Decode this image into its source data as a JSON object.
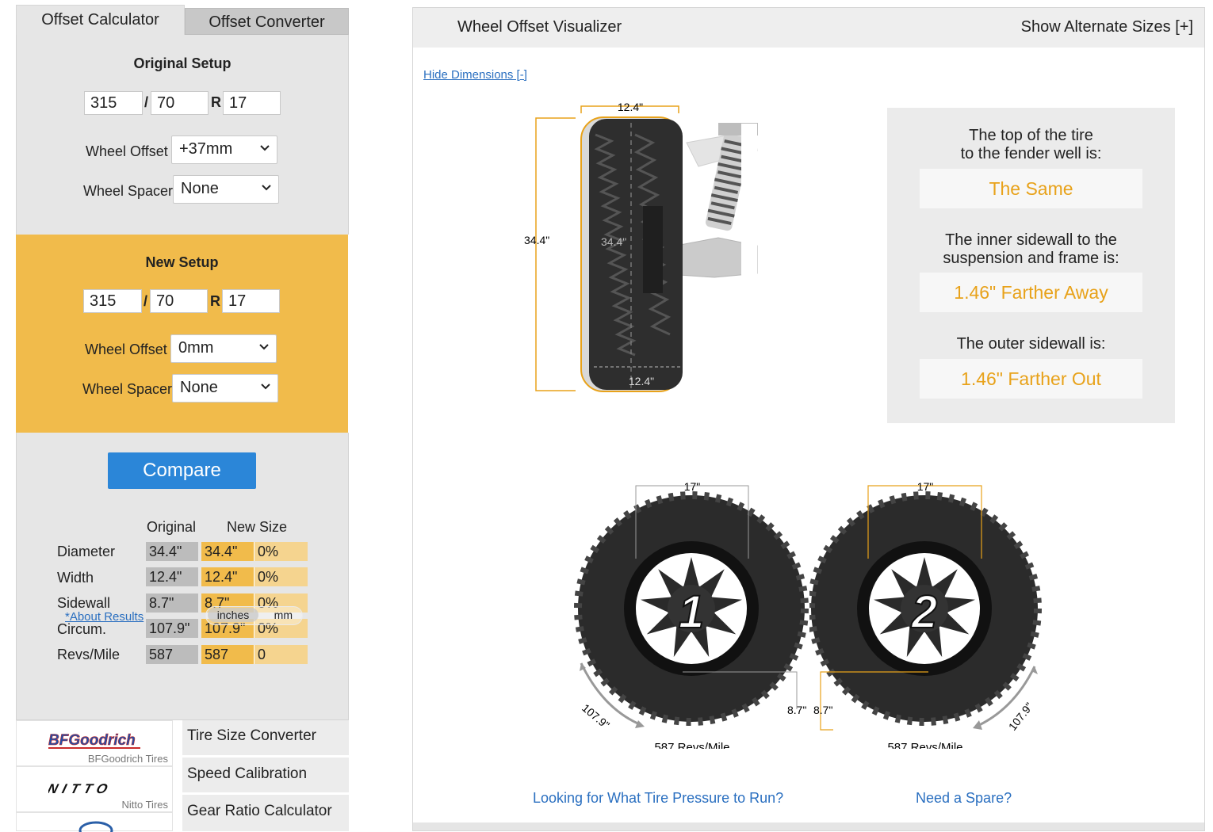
{
  "tabs": {
    "calculator": "Offset Calculator",
    "converter": "Offset Converter"
  },
  "original": {
    "title": "Original Setup",
    "width": "315",
    "aspect": "70",
    "rim": "17",
    "slash": "/",
    "r": "R",
    "offset_label": "Wheel Offset",
    "offset_value": "+37mm",
    "spacer_label": "Wheel Spacer",
    "spacer_value": "None"
  },
  "new_setup": {
    "title": "New Setup",
    "width": "315",
    "aspect": "70",
    "rim": "17",
    "slash": "/",
    "r": "R",
    "offset_label": "Wheel Offset",
    "offset_value": "0mm",
    "spacer_label": "Wheel Spacer",
    "spacer_value": "None"
  },
  "compare_label": "Compare",
  "results": {
    "header_original": "Original",
    "header_new": "New Size",
    "rows": [
      {
        "label": "Diameter",
        "original": "34.4\"",
        "new": "34.4\"",
        "diff": "0%"
      },
      {
        "label": "Width",
        "original": "12.4\"",
        "new": "12.4\"",
        "diff": "0%"
      },
      {
        "label": "Sidewall",
        "original": "8.7\"",
        "new": "8.7\"",
        "diff": "0%"
      },
      {
        "label": "Circum.",
        "original": "107.9\"",
        "new": "107.9\"",
        "diff": "0%"
      },
      {
        "label": "Revs/Mile",
        "original": "587",
        "new": "587",
        "diff": "0"
      }
    ],
    "about_link": "*About Results",
    "unit_inches": "inches",
    "unit_mm": "mm"
  },
  "brands": [
    {
      "logo": "BFGoodrich",
      "caption": "BFGoodrich Tires"
    },
    {
      "logo": "NITTO",
      "caption": "Nitto Tires"
    }
  ],
  "side_links": [
    "Tire Size Converter",
    "Speed Calibration",
    "Gear Ratio Calculator"
  ],
  "visualizer": {
    "title": "Wheel Offset Visualizer",
    "alt_sizes": "Show Alternate Sizes [+]",
    "hide_dimensions": "Hide Dimensions [-]",
    "dims": {
      "width_top": "12.4\"",
      "height_left": "34.4\"",
      "height_inner": "34.4\"",
      "width_inner": "12.4\""
    },
    "info": [
      {
        "q1": "The top of the tire",
        "q2": "to the fender well is:",
        "a": "The Same"
      },
      {
        "q1": "The inner sidewall to the",
        "q2": "suspension and frame is:",
        "a": "1.46\" Farther Away"
      },
      {
        "q1": "The outer sidewall is:",
        "q2": "",
        "a": "1.46\" Farther Out"
      }
    ],
    "wheel1": {
      "number": "1",
      "rim": "17\"",
      "sidewall": "8.7\"",
      "circ": "107.9\"",
      "revs": "587 Revs/Mile"
    },
    "wheel2": {
      "number": "2",
      "rim": "17\"",
      "sidewall": "8.7\"",
      "circ": "107.9\"",
      "revs": "587 Revs/Mile"
    },
    "pressure_link": "Looking for What Tire Pressure to Run?",
    "spare_link": "Need a Spare?"
  },
  "colors": {
    "accent": "#f1bb4b",
    "button": "#2b86d8",
    "link": "#2a6fc0",
    "answer": "#e8a21a"
  }
}
